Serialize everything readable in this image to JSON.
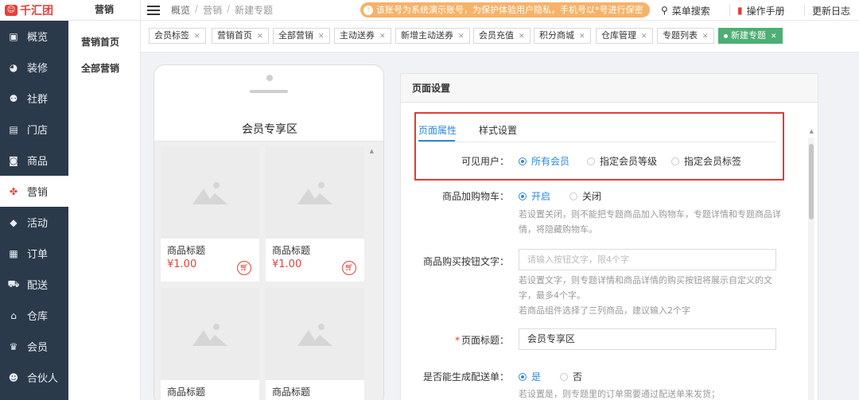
{
  "brand": {
    "logo_text": "千汇团",
    "logo_mark": "☺"
  },
  "sidebar": {
    "items": [
      {
        "label": "概览",
        "icon": "monitor-icon"
      },
      {
        "label": "装修",
        "icon": "palette-icon"
      },
      {
        "label": "社群",
        "icon": "users-icon"
      },
      {
        "label": "门店",
        "icon": "store-icon"
      },
      {
        "label": "商品",
        "icon": "bag-icon"
      },
      {
        "label": "营销",
        "icon": "grid-icon",
        "active": true
      },
      {
        "label": "活动",
        "icon": "tag-icon"
      },
      {
        "label": "订单",
        "icon": "clipboard-icon"
      },
      {
        "label": "配送",
        "icon": "truck-icon"
      },
      {
        "label": "仓库",
        "icon": "warehouse-icon"
      },
      {
        "label": "会员",
        "icon": "crown-icon"
      },
      {
        "label": "合伙人",
        "icon": "partner-icon"
      }
    ]
  },
  "subsidebar": {
    "title": "营销",
    "items": [
      "营销首页",
      "全部营销"
    ]
  },
  "header": {
    "breadcrumb": [
      "概览",
      "营销",
      "新建专题"
    ],
    "notice": "该账号为系统演示账号，为保护体验用户隐私，手机号以*号进行保密",
    "menu_search": "菜单搜索",
    "manual": "操作手册",
    "changelog": "更新日志"
  },
  "tabs": [
    "会员标签",
    "营销首页",
    "全部营销",
    "主动送券",
    "新增主动送券",
    "会员充值",
    "积分商城",
    "仓库管理",
    "专题列表",
    "新建专题"
  ],
  "preview": {
    "title": "会员专享区",
    "products": [
      {
        "title": "商品标题",
        "price": "¥1.00"
      },
      {
        "title": "商品标题",
        "price": "¥1.00"
      },
      {
        "title": "商品标题",
        "price": ""
      },
      {
        "title": "商品标题",
        "price": ""
      }
    ]
  },
  "settings": {
    "header": "页面设置",
    "tab_attr": "页面属性",
    "tab_style": "样式设置",
    "visible_users": {
      "label": "可见用户：",
      "options": [
        "所有会员",
        "指定会员等级",
        "指定会员标签"
      ],
      "selected": 0
    },
    "add_cart": {
      "label": "商品加购物车：",
      "options": [
        "开启",
        "关闭"
      ],
      "selected": 0,
      "help": "若设置关闭，则不能把专题商品加入购物车，专题详情和专题商品详情，将隐藏购物车。"
    },
    "buy_button_text": {
      "label": "商品购买按钮文字：",
      "placeholder": "请输入按钮文字，限4个字",
      "help1": "若设置文字，则专题详情和商品详情的购买按钮将展示自定义的文字，最多4个字。",
      "help2": "若商品组件选择了三列商品，建议输入2个字"
    },
    "page_title": {
      "required": "*",
      "label": "页面标题：",
      "value": "会员专享区"
    },
    "delivery": {
      "label": "是否能生成配送单：",
      "options": [
        "是",
        "否"
      ],
      "selected": 0,
      "help": "若设置是，则专题里的订单需要通过配送单来发货；"
    }
  }
}
